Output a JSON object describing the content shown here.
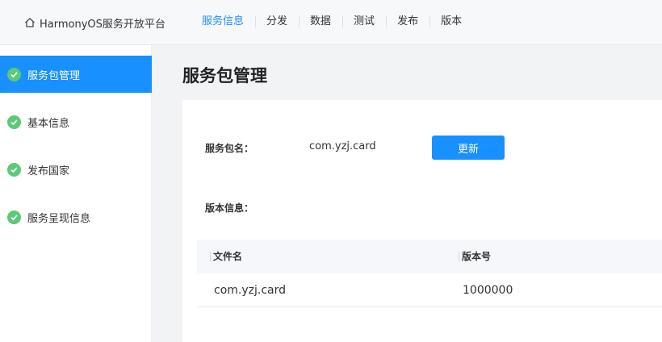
{
  "header": {
    "brand": "HarmonyOS服务开放平台",
    "nav": [
      "服务信息",
      "分发",
      "数据",
      "测试",
      "发布",
      "版本"
    ],
    "active_nav": "服务信息"
  },
  "sidebar": {
    "items": [
      {
        "label": "服务包管理"
      },
      {
        "label": "基本信息"
      },
      {
        "label": "发布国家"
      },
      {
        "label": "服务呈现信息"
      }
    ]
  },
  "main": {
    "title": "服务包管理",
    "package_label": "服务包名：",
    "package_value": "com.yzj.card",
    "update_button": "更新",
    "version_label": "版本信息：",
    "table": {
      "headers": [
        "文件名",
        "版本号"
      ],
      "rows": [
        {
          "file_name": "com.yzj.card",
          "version": "1000000"
        }
      ]
    }
  },
  "colors": {
    "accent": "#1890ff",
    "check": "#5cc977"
  }
}
